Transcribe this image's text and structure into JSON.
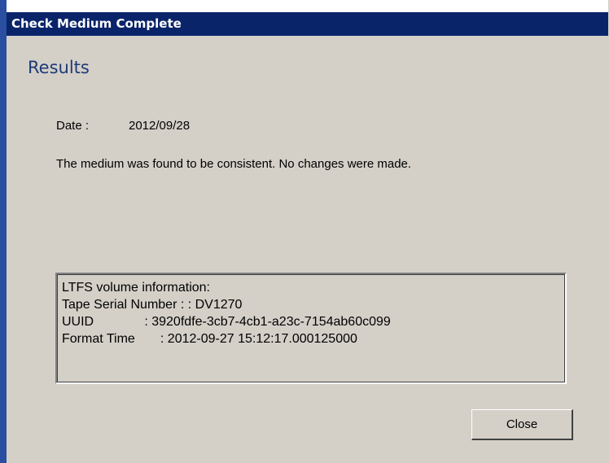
{
  "window": {
    "title": "Check Medium Complete"
  },
  "content": {
    "heading": "Results",
    "date_label": "Date :",
    "date_value": "2012/09/28",
    "message": "The medium was found to be consistent. No changes were made."
  },
  "volume_info": {
    "lines": [
      "LTFS volume information:",
      "Tape Serial Number : : DV1270",
      "UUID              : 3920fdfe-3cb7-4cb1-a23c-7154ab60c099",
      "Format Time       : 2012-09-27 15:12:17.000125000"
    ]
  },
  "buttons": {
    "close_label": "Close"
  },
  "colors": {
    "title_bar": "#0a246a",
    "dialog_bg": "#d4d0c8",
    "heading": "#1e3a78"
  }
}
